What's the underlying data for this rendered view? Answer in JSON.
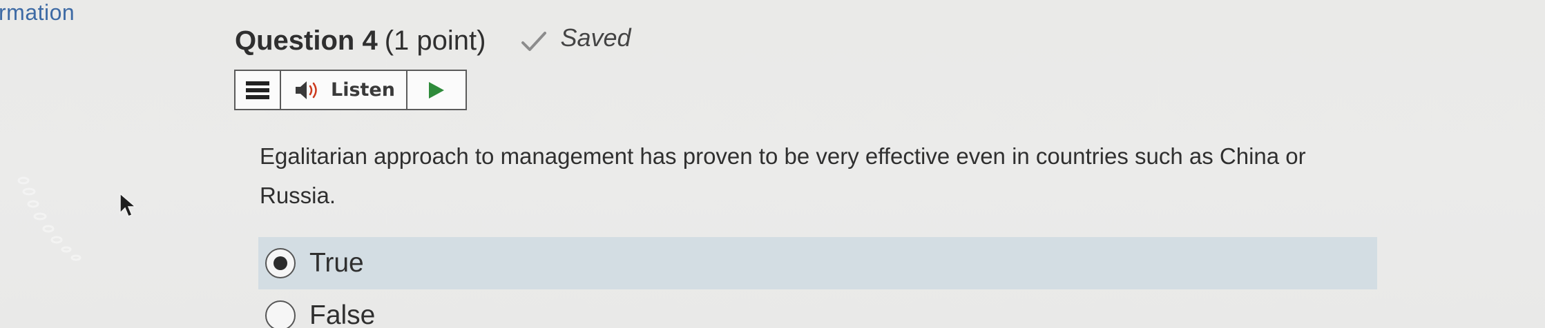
{
  "sidebar": {
    "partial_link": "rmation"
  },
  "question": {
    "title": "Question 4",
    "points": "(1 point)",
    "status": "Saved",
    "text": "Egalitarian approach to management has proven to be very effective even in countries such as China or Russia."
  },
  "toolbar": {
    "menu_icon": "hamburger-icon",
    "speaker_icon": "speaker-icon",
    "listen_label": "Listen",
    "play_icon": "play-icon"
  },
  "options": [
    {
      "label": "True",
      "selected": true
    },
    {
      "label": "False",
      "selected": false
    }
  ],
  "colors": {
    "link": "#3d6aa4",
    "selected_bg": "#d3dde3",
    "play_green": "#2e8b3a",
    "background": "#ebebea"
  }
}
